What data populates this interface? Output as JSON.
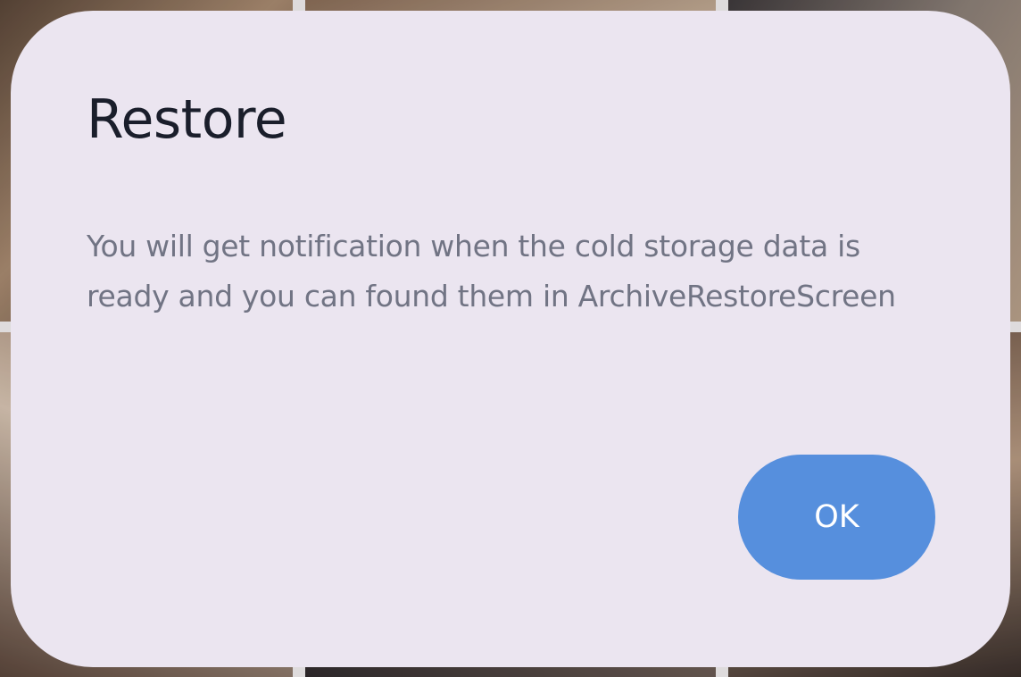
{
  "dialog": {
    "title": "Restore",
    "message": "You will get notification when the cold storage data is ready and you can found them in ArchiveRestoreScreen",
    "ok_label": "OK"
  },
  "colors": {
    "dialog_background": "#ebe5f0",
    "title_text": "#1a1e2b",
    "message_text": "#717484",
    "ok_button": "#568fdd",
    "ok_button_text": "#ffffff"
  }
}
